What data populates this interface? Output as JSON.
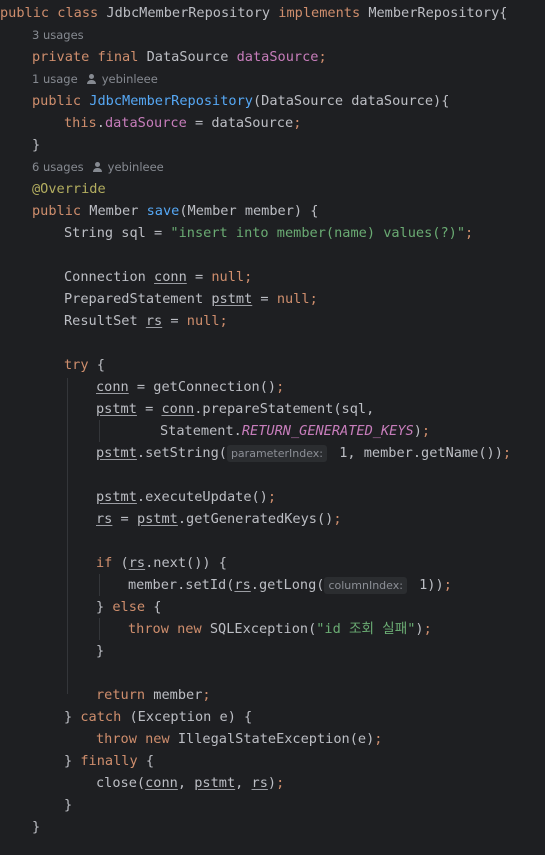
{
  "code": {
    "class_decl": {
      "kw1": "public",
      "kw2": "class",
      "name": "JdbcMemberRepository",
      "kw3": "implements",
      "iface": "MemberRepository",
      "brace": "{"
    },
    "hint_usages_field": "3 usages",
    "field_decl": {
      "kw1": "private",
      "kw2": "final",
      "type": "DataSource",
      "name": "dataSource",
      "semi": ";"
    },
    "hint_ctor": {
      "usages": "1 usage",
      "author": "yebinleee"
    },
    "ctor_decl": {
      "kw": "public",
      "name": "JdbcMemberRepository",
      "params": "(DataSource dataSource){"
    },
    "ctor_body": {
      "this": "this",
      "dot": ".",
      "field": "dataSource",
      "rest": " = dataSource",
      "semi": ";"
    },
    "ctor_close": "}",
    "hint_save": {
      "usages": "6 usages",
      "author": "yebinleee"
    },
    "override": "@Override",
    "save_decl": {
      "kw": "public",
      "type": " Member ",
      "name": "save",
      "params": "(Member member) {"
    },
    "sql_decl": {
      "pre": "String sql = ",
      "str": "\"insert into member(name) values(?)\"",
      "semi": ";"
    },
    "conn_decl": {
      "type": "Connection ",
      "var": "conn",
      "eq": " = ",
      "null": "null",
      "semi": ";"
    },
    "pstmt_decl": {
      "type": "PreparedStatement ",
      "var": "pstmt",
      "eq": " = ",
      "null": "null",
      "semi": ";"
    },
    "rs_decl": {
      "type": "ResultSet ",
      "var": "rs",
      "eq": " = ",
      "null": "null",
      "semi": ";"
    },
    "try_line": {
      "kw": "try",
      "brace": " {"
    },
    "get_conn": {
      "var": "conn",
      "rest": " = getConnection()",
      "semi": ";"
    },
    "prep1": {
      "var": "pstmt",
      "eq": " = ",
      "obj": "conn",
      "rest": ".prepareStatement(sql,",
      "tail": ""
    },
    "prep2": {
      "cls": "Statement.",
      "const": "RETURN_GENERATED_KEYS",
      "rest": ")",
      "semi": ";"
    },
    "set_string": {
      "var": "pstmt",
      "call": ".setString(",
      "inlay": "parameterIndex:",
      "rest": " 1, member.getName())",
      "semi": ";"
    },
    "exec_update": {
      "var": "pstmt",
      "rest": ".executeUpdate()",
      "semi": ";"
    },
    "gen_keys": {
      "var": "rs",
      "eq": " = ",
      "obj": "pstmt",
      "rest": ".getGeneratedKeys()",
      "semi": ";"
    },
    "if_line": {
      "kw": "if",
      "pre": " (",
      "var": "rs",
      "rest": ".next()) {"
    },
    "set_id": {
      "pre": "member.setId(",
      "var": "rs",
      "call": ".getLong(",
      "inlay": "columnIndex:",
      "rest": " 1))",
      "semi": ";"
    },
    "else_line": {
      "pre": "} ",
      "kw": "else",
      "rest": " {"
    },
    "throw1": {
      "kw1": "throw",
      "kw2": " new",
      "rest": " SQLException(",
      "str": "\"id 조회 실패\"",
      "tail": ")",
      "semi": ";"
    },
    "if_close": "}",
    "return_line": {
      "kw": "return",
      "rest": " member",
      "semi": ";"
    },
    "catch_line": {
      "pre": "} ",
      "kw": "catch",
      "rest": " (Exception e) {"
    },
    "throw2": {
      "kw1": "throw",
      "kw2": " new",
      "rest": " IllegalStateException(e)",
      "semi": ";"
    },
    "finally_line": {
      "pre": "} ",
      "kw": "finally",
      "rest": " {"
    },
    "close_line": {
      "pre": "close(",
      "v1": "conn",
      "c1": ", ",
      "v2": "pstmt",
      "c2": ", ",
      "v3": "rs",
      "rest": ")",
      "semi": ";"
    },
    "try_close": "}",
    "method_close": "}"
  }
}
